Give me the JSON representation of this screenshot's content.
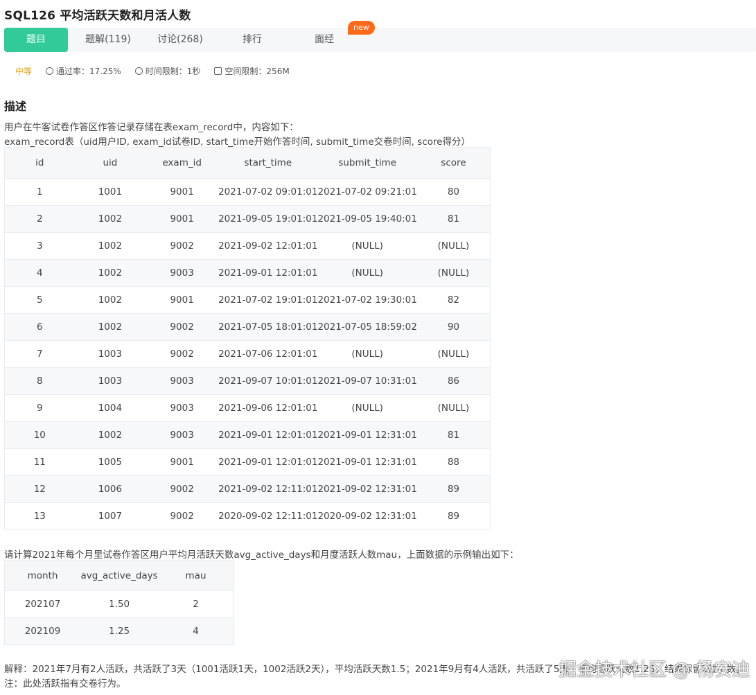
{
  "title": "SQL126  平均活跃天数和月活人数",
  "tabs": [
    {
      "label": "题目"
    },
    {
      "label": "题解(119)"
    },
    {
      "label": "讨论(268)"
    },
    {
      "label": "排行"
    },
    {
      "label": "面经"
    }
  ],
  "new_badge": "new",
  "meta": {
    "level": "中等",
    "pass_rate": "通过率：17.25%",
    "time_limit": "时间限制：1秒",
    "space_limit": "空间限制：256M"
  },
  "description_heading": "描述",
  "desc_line1": "用户在牛客试卷作答区作答记录存储在表exam_record中，内容如下：",
  "desc_line2": "exam_record表（uid用户ID, exam_id试卷ID, start_time开始作答时间, submit_time交卷时间, score得分）",
  "exam_record": {
    "headers": [
      "id",
      "uid",
      "exam_id",
      "start_time",
      "submit_time",
      "score"
    ],
    "rows": [
      [
        "1",
        "1001",
        "9001",
        "2021-07-02 09:01:01",
        "2021-07-02 09:21:01",
        "80"
      ],
      [
        "2",
        "1002",
        "9001",
        "2021-09-05 19:01:01",
        "2021-09-05 19:40:01",
        "81"
      ],
      [
        "3",
        "1002",
        "9002",
        "2021-09-02 12:01:01",
        "(NULL)",
        "(NULL)"
      ],
      [
        "4",
        "1002",
        "9003",
        "2021-09-01 12:01:01",
        "(NULL)",
        "(NULL)"
      ],
      [
        "5",
        "1002",
        "9001",
        "2021-07-02 19:01:01",
        "2021-07-02 19:30:01",
        "82"
      ],
      [
        "6",
        "1002",
        "9002",
        "2021-07-05 18:01:01",
        "2021-07-05 18:59:02",
        "90"
      ],
      [
        "7",
        "1003",
        "9002",
        "2021-07-06 12:01:01",
        "(NULL)",
        "(NULL)"
      ],
      [
        "8",
        "1003",
        "9003",
        "2021-09-07 10:01:01",
        "2021-09-07 10:31:01",
        "86"
      ],
      [
        "9",
        "1004",
        "9003",
        "2021-09-06 12:01:01",
        "(NULL)",
        "(NULL)"
      ],
      [
        "10",
        "1002",
        "9003",
        "2021-09-01 12:01:01",
        "2021-09-01 12:31:01",
        "81"
      ],
      [
        "11",
        "1005",
        "9001",
        "2021-09-01 12:01:01",
        "2021-09-01 12:31:01",
        "88"
      ],
      [
        "12",
        "1006",
        "9002",
        "2021-09-02 12:11:01",
        "2021-09-02 12:31:01",
        "89"
      ],
      [
        "13",
        "1007",
        "9002",
        "2020-09-02 12:11:01",
        "2020-09-02 12:31:01",
        "89"
      ]
    ]
  },
  "question": "请计算2021年每个月里试卷作答区用户平均月活跃天数avg_active_days和月度活跃人数mau，上面数据的示例输出如下：",
  "output": {
    "headers": [
      "month",
      "avg_active_days",
      "mau"
    ],
    "rows": [
      [
        "202107",
        "1.50",
        "2"
      ],
      [
        "202109",
        "1.25",
        "4"
      ]
    ]
  },
  "explain1": "解释：2021年7月有2人活跃，共活跃了3天（1001活跃1天，1002活跃2天），平均活跃天数1.5；2021年9月有4人活跃，共活跃了5天，平均活跃天数1.25，结果保留2位小数。",
  "explain2": "注：此处活跃指有交卷行为。",
  "watermark": "掘金技术社区 @ 杨安迪"
}
